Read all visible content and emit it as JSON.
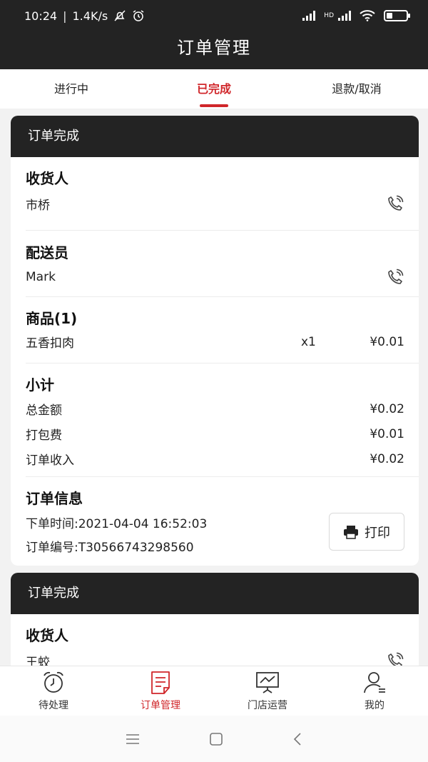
{
  "status": {
    "time": "10:24",
    "speed": "1.4K/s",
    "hd": "HD"
  },
  "app_title": "订单管理",
  "tabs": [
    {
      "label": "进行中",
      "active": false
    },
    {
      "label": "已完成",
      "active": true
    },
    {
      "label": "退款/取消",
      "active": false
    }
  ],
  "order1": {
    "status": "订单完成",
    "receiver_title": "收货人",
    "receiver_name": "市桥",
    "courier_title": "配送员",
    "courier_name": "Mark",
    "goods_title": "商品(1)",
    "goods": [
      {
        "name": "五香扣肉",
        "qty": "x1",
        "price": "¥0.01"
      }
    ],
    "subtotal_title": "小计",
    "subtotal": [
      {
        "label": "总金额",
        "value": "¥0.02"
      },
      {
        "label": "打包费",
        "value": "¥0.01"
      },
      {
        "label": "订单收入",
        "value": "¥0.02"
      }
    ],
    "info_title": "订单信息",
    "order_time": "下单时间:2021-04-04 16:52:03",
    "order_no": "订单编号:T30566743298560",
    "print_label": "打印"
  },
  "order2": {
    "status": "订单完成",
    "receiver_title": "收货人",
    "receiver_name": "王蛟"
  },
  "bottom_nav": [
    {
      "label": "待处理",
      "icon": "alarm-clock-icon",
      "active": false
    },
    {
      "label": "订单管理",
      "icon": "order-list-icon",
      "active": true
    },
    {
      "label": "门店运营",
      "icon": "store-chart-icon",
      "active": false
    },
    {
      "label": "我的",
      "icon": "user-icon",
      "active": false
    }
  ],
  "colors": {
    "accent": "#d0262a",
    "header": "#232323",
    "background": "#f2f2f2"
  }
}
